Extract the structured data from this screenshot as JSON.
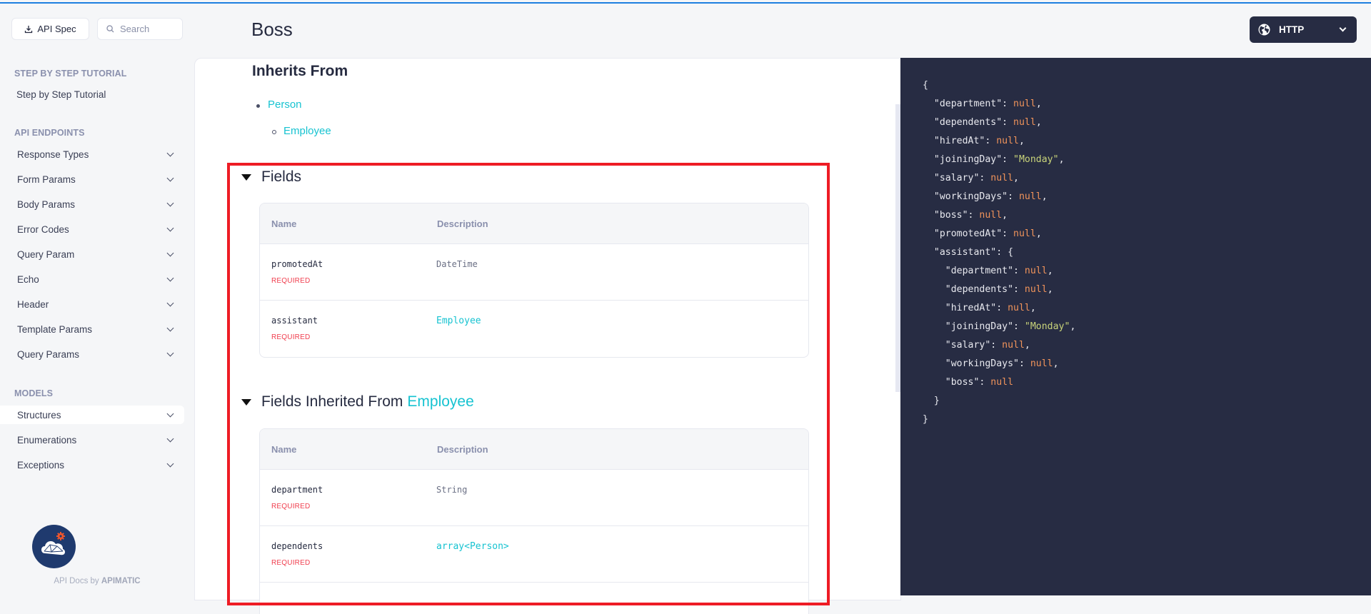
{
  "sidebar": {
    "api_spec_label": "API Spec",
    "search_placeholder": "Search",
    "sections": [
      {
        "heading": "STEP BY STEP TUTORIAL",
        "links": [
          "Step by Step Tutorial"
        ]
      },
      {
        "heading": "API ENDPOINTS",
        "items": [
          "Response Types",
          "Form Params",
          "Body Params",
          "Error Codes",
          "Query Param",
          "Echo",
          "Header",
          "Template Params",
          "Query Params"
        ]
      },
      {
        "heading": "MODELS",
        "items": [
          "Structures",
          "Enumerations",
          "Exceptions"
        ],
        "active": "Structures"
      }
    ],
    "footer_prefix": "API Docs by",
    "footer_brand": "APIMATIC"
  },
  "header": {
    "title": "Boss",
    "language_selector": "HTTP"
  },
  "main": {
    "inherits_heading": "Inherits From",
    "inherits": [
      {
        "label": "Person",
        "level": 0
      },
      {
        "label": "Employee",
        "level": 1
      }
    ],
    "fields_section": {
      "heading": "Fields",
      "columns": [
        "Name",
        "Description"
      ],
      "rows": [
        {
          "name": "promotedAt",
          "badge": "REQUIRED",
          "type": "DateTime",
          "type_is_link": false
        },
        {
          "name": "assistant",
          "badge": "REQUIRED",
          "type": "Employee",
          "type_is_link": true
        }
      ]
    },
    "inherited_section": {
      "heading_prefix": "Fields Inherited From",
      "heading_link": "Employee",
      "columns": [
        "Name",
        "Description"
      ],
      "rows": [
        {
          "name": "department",
          "badge": "REQUIRED",
          "type": "String",
          "type_is_link": false
        },
        {
          "name": "dependents",
          "badge": "REQUIRED",
          "type": "array<Person>",
          "type_is_link": true
        }
      ]
    }
  },
  "code_sample": {
    "lines": [
      [
        {
          "t": "{"
        }
      ],
      [
        {
          "t": "  \"department\": "
        },
        {
          "t": "null",
          "k": "null"
        },
        {
          "t": ","
        }
      ],
      [
        {
          "t": "  \"dependents\": "
        },
        {
          "t": "null",
          "k": "null"
        },
        {
          "t": ","
        }
      ],
      [
        {
          "t": "  \"hiredAt\": "
        },
        {
          "t": "null",
          "k": "null"
        },
        {
          "t": ","
        }
      ],
      [
        {
          "t": "  \"joiningDay\": "
        },
        {
          "t": "\"Monday\"",
          "k": "str"
        },
        {
          "t": ","
        }
      ],
      [
        {
          "t": "  \"salary\": "
        },
        {
          "t": "null",
          "k": "null"
        },
        {
          "t": ","
        }
      ],
      [
        {
          "t": "  \"workingDays\": "
        },
        {
          "t": "null",
          "k": "null"
        },
        {
          "t": ","
        }
      ],
      [
        {
          "t": "  \"boss\": "
        },
        {
          "t": "null",
          "k": "null"
        },
        {
          "t": ","
        }
      ],
      [
        {
          "t": "  \"promotedAt\": "
        },
        {
          "t": "null",
          "k": "null"
        },
        {
          "t": ","
        }
      ],
      [
        {
          "t": "  \"assistant\": {"
        }
      ],
      [
        {
          "t": "    \"department\": "
        },
        {
          "t": "null",
          "k": "null"
        },
        {
          "t": ","
        }
      ],
      [
        {
          "t": "    \"dependents\": "
        },
        {
          "t": "null",
          "k": "null"
        },
        {
          "t": ","
        }
      ],
      [
        {
          "t": "    \"hiredAt\": "
        },
        {
          "t": "null",
          "k": "null"
        },
        {
          "t": ","
        }
      ],
      [
        {
          "t": "    \"joiningDay\": "
        },
        {
          "t": "\"Monday\"",
          "k": "str"
        },
        {
          "t": ","
        }
      ],
      [
        {
          "t": "    \"salary\": "
        },
        {
          "t": "null",
          "k": "null"
        },
        {
          "t": ","
        }
      ],
      [
        {
          "t": "    \"workingDays\": "
        },
        {
          "t": "null",
          "k": "null"
        },
        {
          "t": ","
        }
      ],
      [
        {
          "t": "    \"boss\": "
        },
        {
          "t": "null",
          "k": "null"
        }
      ],
      [
        {
          "t": "  }"
        }
      ],
      [
        {
          "t": "}"
        }
      ]
    ]
  },
  "colors": {
    "accent_link": "#17c3d1",
    "required": "#f03e4e",
    "code_bg": "#272c43",
    "code_null": "#f0935a",
    "code_string": "#c9d47a",
    "highlight_box": "#ee1c25",
    "top_bar": "#1e7fe0"
  }
}
